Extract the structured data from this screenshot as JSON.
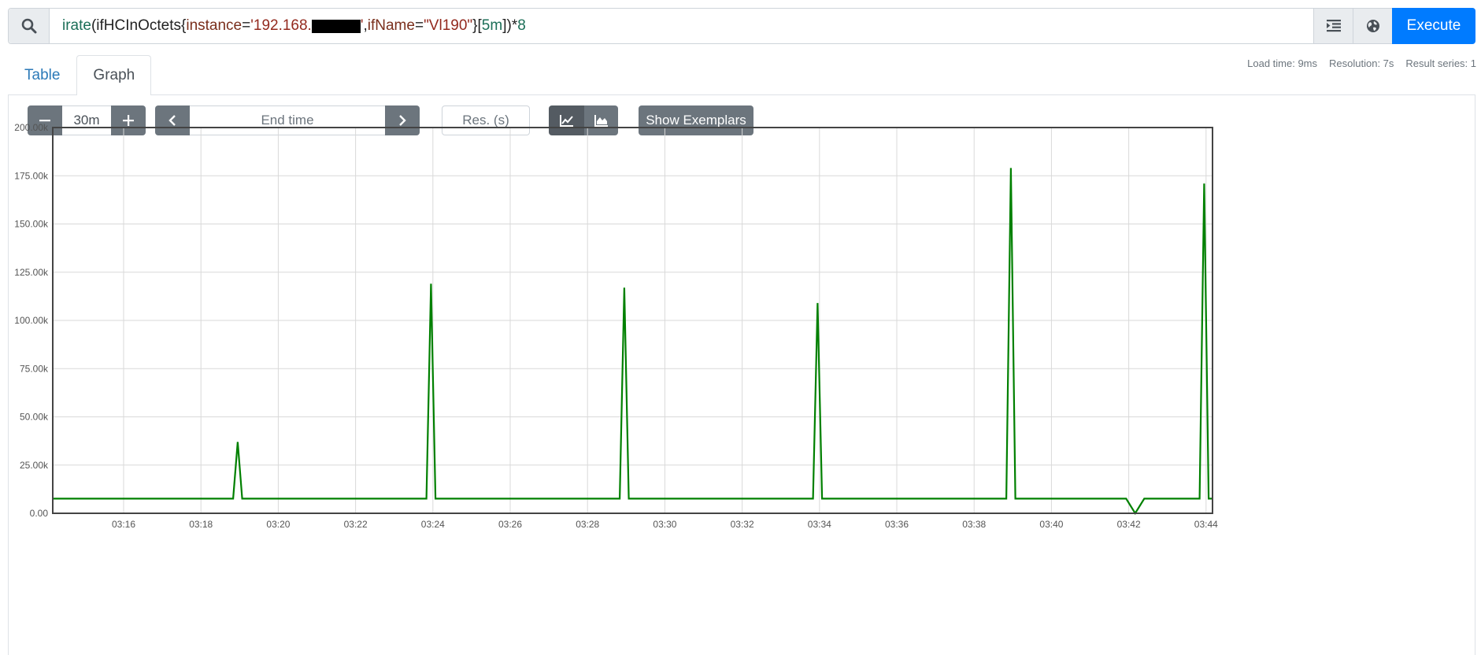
{
  "query": {
    "tokens": [
      {
        "text": "irate",
        "cls": "tok-fn"
      },
      {
        "text": "(",
        "cls": "tok-metric"
      },
      {
        "text": "ifHCInOctets",
        "cls": "tok-metric"
      },
      {
        "text": "{",
        "cls": "tok-metric"
      },
      {
        "text": "instance",
        "cls": "tok-label"
      },
      {
        "text": "=",
        "cls": "tok-metric"
      },
      {
        "text": "'192.168.",
        "cls": "tok-str"
      },
      {
        "text": "",
        "cls": "redact"
      },
      {
        "text": "'",
        "cls": "tok-str"
      },
      {
        "text": ", ",
        "cls": "tok-metric"
      },
      {
        "text": "ifName",
        "cls": "tok-label"
      },
      {
        "text": "=",
        "cls": "tok-metric"
      },
      {
        "text": "\"Vl190\"",
        "cls": "tok-str"
      },
      {
        "text": "}",
        "cls": "tok-metric"
      },
      {
        "text": "[",
        "cls": "tok-metric"
      },
      {
        "text": "5m",
        "cls": "tok-num"
      },
      {
        "text": "]",
        "cls": "tok-metric"
      },
      {
        "text": ") ",
        "cls": "tok-metric"
      },
      {
        "text": "*",
        "cls": "tok-metric"
      },
      {
        "text": "8",
        "cls": "tok-num"
      }
    ],
    "execute_label": "Execute"
  },
  "tabs": [
    {
      "label": "Table",
      "active": false
    },
    {
      "label": "Graph",
      "active": true
    }
  ],
  "stats": {
    "load_time": "Load time: 9ms",
    "resolution": "Resolution: 7s",
    "result_series": "Result series: 1"
  },
  "controls": {
    "range": "30m",
    "end_time_placeholder": "End time",
    "res_placeholder": "Res. (s)",
    "exemplars_label": "Show Exemplars"
  },
  "colors": {
    "series": "#008000",
    "primary": "#007bff",
    "secondary": "#6c757d"
  },
  "chart_data": {
    "type": "line",
    "ylim": [
      0,
      200000
    ],
    "yticks": [
      0,
      25000,
      50000,
      75000,
      100000,
      125000,
      150000,
      175000,
      200000
    ],
    "ytick_labels": [
      "0.00",
      "25.00k",
      "50.00k",
      "75.00k",
      "100.00k",
      "125.00k",
      "150.00k",
      "175.00k",
      "200.00k"
    ],
    "xlim": [
      "03:14:10",
      "03:44:10"
    ],
    "xticks": [
      "03:16",
      "03:18",
      "03:20",
      "03:22",
      "03:24",
      "03:26",
      "03:28",
      "03:30",
      "03:32",
      "03:34",
      "03:36",
      "03:38",
      "03:40",
      "03:42",
      "03:44"
    ],
    "baseline": 7600,
    "series": [
      {
        "points": [
          [
            "03:14:10",
            7600
          ],
          [
            "03:18:50",
            7600
          ],
          [
            "03:18:57",
            37000
          ],
          [
            "03:19:04",
            7600
          ],
          [
            "03:23:50",
            7600
          ],
          [
            "03:23:57",
            119000
          ],
          [
            "03:24:04",
            7600
          ],
          [
            "03:28:50",
            7600
          ],
          [
            "03:28:57",
            117000
          ],
          [
            "03:29:04",
            7600
          ],
          [
            "03:33:50",
            7600
          ],
          [
            "03:33:57",
            109000
          ],
          [
            "03:34:04",
            7600
          ],
          [
            "03:38:50",
            7600
          ],
          [
            "03:38:57",
            179000
          ],
          [
            "03:39:04",
            7600
          ],
          [
            "03:41:56",
            7600
          ],
          [
            "03:42:10",
            0
          ],
          [
            "03:42:24",
            7600
          ],
          [
            "03:43:50",
            7600
          ],
          [
            "03:43:57",
            171000
          ],
          [
            "03:44:04",
            7600
          ],
          [
            "03:44:10",
            7600
          ]
        ]
      }
    ]
  }
}
